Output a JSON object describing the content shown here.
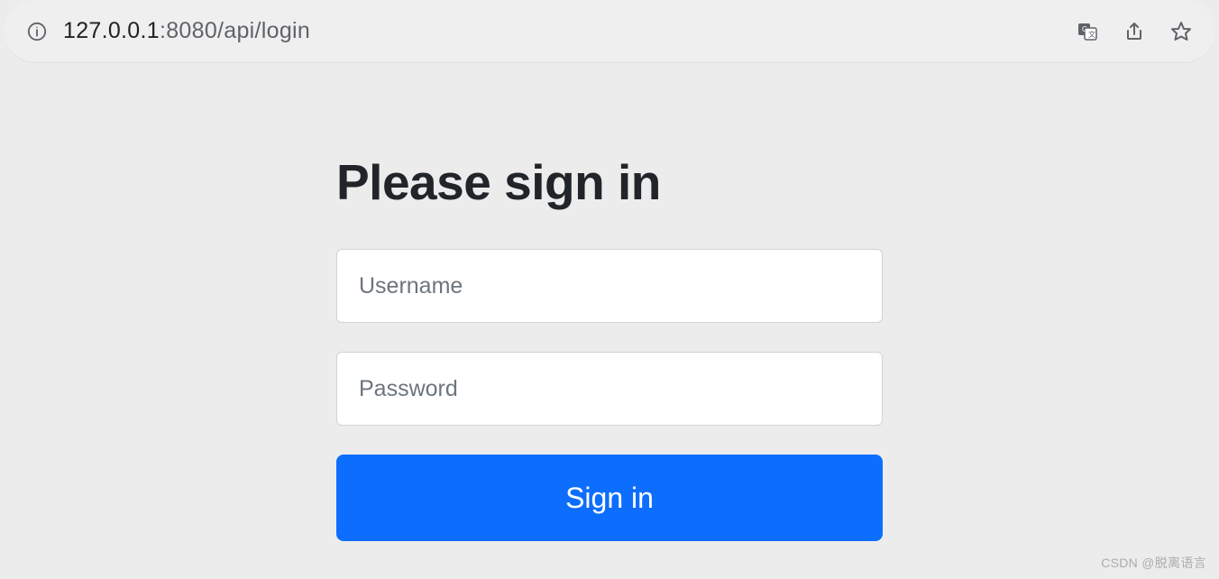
{
  "browser": {
    "url_host": "127.0.0.1",
    "url_path": ":8080/api/login",
    "icons": {
      "info": "info-icon",
      "translate": "translate-icon",
      "share": "share-icon",
      "star": "star-icon"
    }
  },
  "login": {
    "heading": "Please sign in",
    "username_placeholder": "Username",
    "username_value": "",
    "password_placeholder": "Password",
    "password_value": "",
    "submit_label": "Sign in"
  },
  "watermark": "CSDN @脱离语言"
}
